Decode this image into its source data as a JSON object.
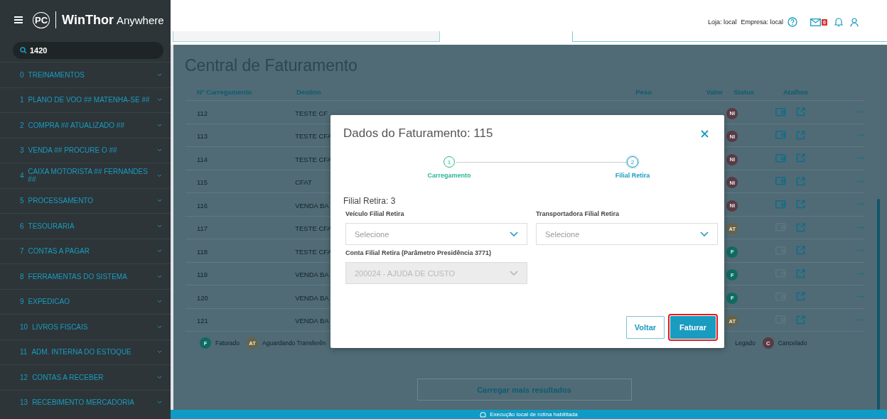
{
  "logo": {
    "mark": "PC",
    "title": "WinThor",
    "subtitle": "Anywhere"
  },
  "search": {
    "value": "1420"
  },
  "sidebar": {
    "items": [
      {
        "number": "0",
        "label": "TREINAMENTOS"
      },
      {
        "number": "1",
        "label": "PLANO DE VOO ## MATENHA-SE ##"
      },
      {
        "number": "2",
        "label": "COMPRA ## ATUALIZADO ##"
      },
      {
        "number": "3",
        "label": "VENDA ## PROCURE O ##"
      },
      {
        "number": "4",
        "label": "CAIXA MOTORISTA ## FERNANDES ##"
      },
      {
        "number": "5",
        "label": "PROCESSAMENTO"
      },
      {
        "number": "6",
        "label": "TESOURARIA"
      },
      {
        "number": "7",
        "label": "CONTAS A PAGAR"
      },
      {
        "number": "8",
        "label": "FERRAMENTAS DO SISTEMA"
      },
      {
        "number": "9",
        "label": "EXPEDICAO"
      },
      {
        "number": "10",
        "label": "LIVROS FISCAIS"
      },
      {
        "number": "11",
        "label": "ADM. INTERNA DO ESTOQUE"
      },
      {
        "number": "12",
        "label": "CONTAS A RECEBER"
      },
      {
        "number": "13",
        "label": "RECEBIMENTO MERCADORIA"
      }
    ]
  },
  "header": {
    "store": "Loja: local",
    "company": "Empresa: local",
    "mail_count": "0"
  },
  "page_title": "Central de Faturamento",
  "table": {
    "columns": [
      "Nº Carregamento",
      "Destino",
      "Peso",
      "Valor",
      "Status",
      "Atalhos"
    ],
    "rows": [
      {
        "number": "112",
        "destination": "TESTE CF",
        "status": "NI",
        "color": "#5a3a44",
        "wallet_enabled": true
      },
      {
        "number": "113",
        "destination": "TESTE CFA",
        "status": "NI",
        "color": "#5a3a44",
        "wallet_enabled": true
      },
      {
        "number": "114",
        "destination": "TESTE CFA",
        "status": "NI",
        "color": "#5a3a44",
        "wallet_enabled": true
      },
      {
        "number": "115",
        "destination": "CFAT",
        "status": "NI",
        "color": "#5a3a44",
        "wallet_enabled": true
      },
      {
        "number": "116",
        "destination": "VENDA BA",
        "status": "NI",
        "color": "#5a3a44",
        "wallet_enabled": true
      },
      {
        "number": "117",
        "destination": "TESTE CFA",
        "status": "AT",
        "color": "#6b6245",
        "wallet_enabled": false
      },
      {
        "number": "118",
        "destination": "TESTE CFA",
        "status": "F",
        "color": "#0f6a62",
        "wallet_enabled": false
      },
      {
        "number": "119",
        "destination": "VENDA BA",
        "status": "F",
        "color": "#0f6a62",
        "wallet_enabled": false
      },
      {
        "number": "120",
        "destination": "VENDA BA",
        "status": "F",
        "color": "#0f6a62",
        "wallet_enabled": false
      },
      {
        "number": "121",
        "destination": "VENDA BA",
        "status": "AT",
        "color": "#6b6245",
        "wallet_enabled": false
      }
    ]
  },
  "legend": [
    {
      "badge": "F",
      "label": "Faturado",
      "color": "#0f6a62"
    },
    {
      "badge": "AT",
      "label": "Aguardando Transferên",
      "color": "#6b6245"
    },
    {
      "badge": "C",
      "label": "Cancelado",
      "color": "#5a3a44"
    }
  ],
  "legend_partial_label": "Legado",
  "load_more": "Carregar mais resultados",
  "status_bar": "Execução local de rotina habilitada",
  "modal": {
    "title": "Dados do Faturamento: 115",
    "steps": [
      {
        "number": "1",
        "label": "Carregamento",
        "completed": true,
        "selected": false
      },
      {
        "number": "2",
        "label": "Filial Retira",
        "completed": false,
        "selected": true
      }
    ],
    "subtitle": "Filial Retira: 3",
    "fields": [
      {
        "label": "Veículo Filial Retira",
        "placeholder": "Selecione",
        "disabled": false
      },
      {
        "label": "Transportadora Filial Retira",
        "placeholder": "Selecione",
        "disabled": false
      },
      {
        "label": "Conta Filial Retira (Parâmetro Presidência 3771)",
        "value": "200024 - AJUDA DE CUSTO",
        "disabled": true
      }
    ],
    "buttons": [
      {
        "label": "Voltar",
        "kind": "secondary",
        "highlighted": false
      },
      {
        "label": "Faturar",
        "kind": "primary",
        "highlighted": true
      }
    ]
  }
}
